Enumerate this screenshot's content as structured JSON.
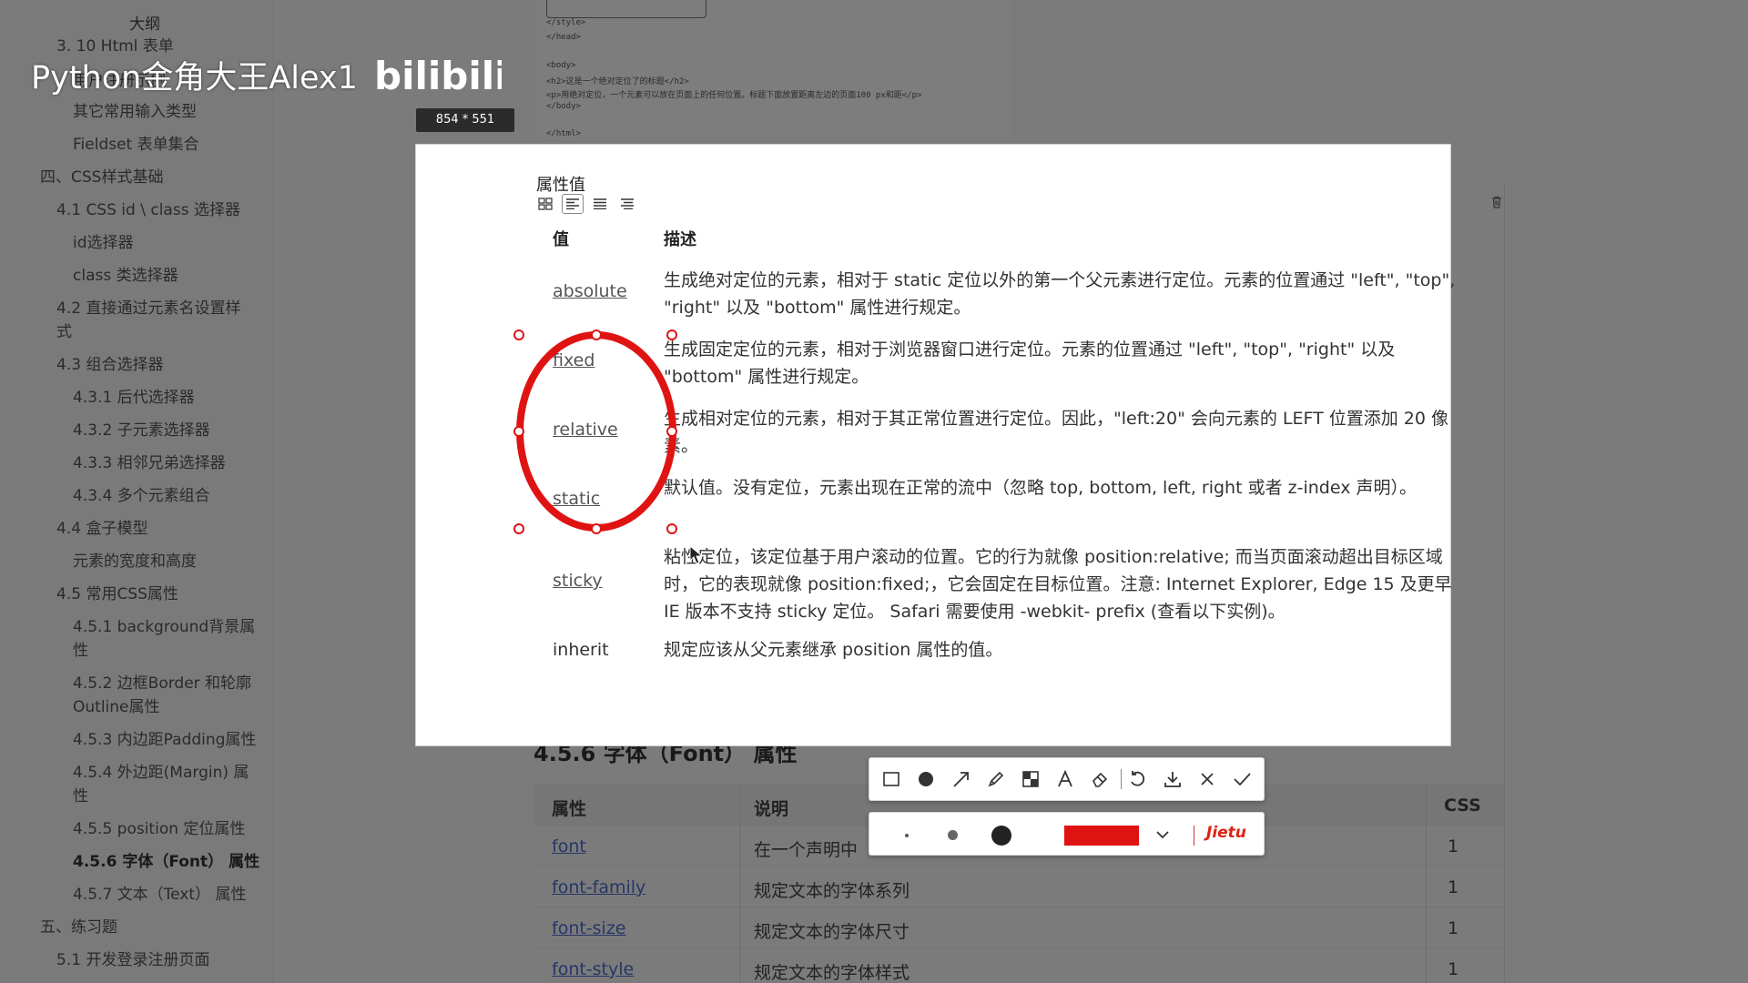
{
  "watermark": {
    "text": "Python金角大王Alex1",
    "logo": "bilibili"
  },
  "sidebar": {
    "outline_title": "大纲",
    "items": [
      "3. 10 Html 表单",
      "用户注册示例",
      "其它常用输入类型",
      "Fieldset 表单集合",
      "四、CSS样式基础",
      "4.1 CSS id \\ class 选择器",
      "id选择器",
      "class 类选择器",
      "4.2 直接通过元素名设置样",
      "式",
      "4.3 组合选择器",
      "4.3.1 后代选择器",
      "4.3.2 子元素选择器",
      "4.3.3 相邻兄弟选择器",
      "4.3.4 多个元素组合",
      "4.4 盒子模型",
      "元素的宽度和高度",
      "4.5 常用CSS属性",
      "4.5.1 background背景属",
      "性",
      "4.5.2 边框Border 和轮廓",
      "Outline属性",
      "4.5.3 内边距Padding属性",
      "4.5.4 外边距(Margin) 属",
      "性",
      "4.5.5 position 定位属性",
      "4.5.6 字体（Font） 属性",
      "4.5.7 文本（Text） 属性",
      "五、练习题",
      "5.1 开发登录注册页面"
    ]
  },
  "code_snippet": [
    "</style>",
    "</head>",
    "<body>",
    "<h2>这是一个绝对定位了的标题</h2>",
    "<p>用绝对定位，一个元素可以放在页面上的任何位置。标题下面放置距离左边的页面100 px和距</p>",
    "</body>",
    "</html>"
  ],
  "size_badge": "854 * 551",
  "capture": {
    "section_title": "属性值",
    "headers": {
      "value": "值",
      "description": "描述"
    },
    "rows": [
      {
        "value": "absolute",
        "desc": "生成绝对定位的元素，相对于 static 定位以外的第一个父元素进行定位。元素的位置通过 \"left\", \"top\", \"right\" 以及 \"bottom\" 属性进行规定。"
      },
      {
        "value": "fixed",
        "desc": "生成固定定位的元素，相对于浏览器窗口进行定位。元素的位置通过 \"left\", \"top\", \"right\" 以及 \"bottom\" 属性进行规定。"
      },
      {
        "value": "relative",
        "desc": "生成相对定位的元素，相对于其正常位置进行定位。因此，\"left:20\" 会向元素的 LEFT 位置添加 20 像素。"
      },
      {
        "value": "static",
        "desc": "默认值。没有定位，元素出现在正常的流中（忽略 top, bottom, left, right 或者 z-index 声明）。"
      },
      {
        "value": "sticky",
        "desc": "粘性定位，该定位基于用户滚动的位置。它的行为就像 position:relative; 而当页面滚动超出目标区域时，它的表现就像 position:fixed;，它会固定在目标位置。注意: Internet Explorer, Edge 15 及更早 IE 版本不支持 sticky 定位。 Safari 需要使用 -webkit- prefix (查看以下实例)。"
      },
      {
        "value": "inherit",
        "desc": "规定应该从父元素继承 position 属性的值。"
      }
    ]
  },
  "background_section": {
    "heading": "4.5.6 字体（Font） 属性",
    "headers": [
      "属性",
      "说明",
      "CSS"
    ],
    "rows": [
      {
        "prop": "font",
        "desc": "在一个声明中",
        "css": "1"
      },
      {
        "prop": "font-family",
        "desc": "规定文本的字体系列",
        "css": "1"
      },
      {
        "prop": "font-size",
        "desc": "规定文本的字体尺寸",
        "css": "1"
      },
      {
        "prop": "font-style",
        "desc": "规定文本的字体样式",
        "css": "1"
      }
    ]
  },
  "toolbar": {
    "tools": [
      "rectangle-icon",
      "ellipse-icon",
      "arrow-icon",
      "pencil-icon",
      "mosaic-icon",
      "text-icon",
      "eraser-icon",
      "undo-icon",
      "download-icon",
      "close-icon",
      "check-icon"
    ],
    "brand": "Jietu",
    "annotation_color": "#e01313"
  }
}
